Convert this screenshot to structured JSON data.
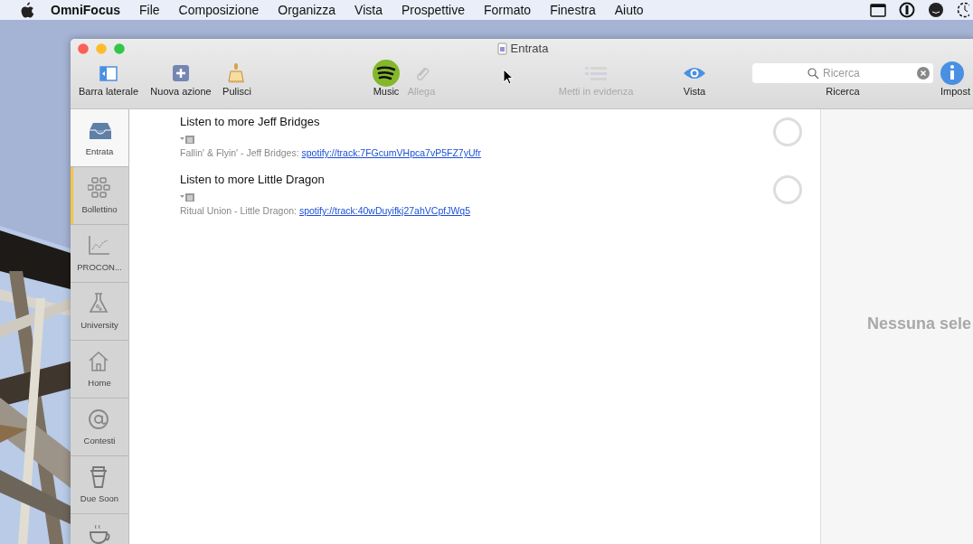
{
  "menu_bar": {
    "app": "OmniFocus",
    "menus": [
      "File",
      "Composizione",
      "Organizza",
      "Vista",
      "Prospettive",
      "Formato",
      "Finestra",
      "Aiuto"
    ]
  },
  "window": {
    "title": "Entrata"
  },
  "toolbar": {
    "items": [
      {
        "kind": "button",
        "label": "Barra laterale",
        "disabled": false
      },
      {
        "kind": "button",
        "label": "Nuova azione",
        "disabled": false
      },
      {
        "kind": "button",
        "label": "Pulisci",
        "disabled": false
      },
      {
        "kind": "button",
        "label": "Music",
        "disabled": false
      },
      {
        "kind": "button",
        "label": "Allega",
        "disabled": true
      },
      {
        "kind": "button",
        "label": "Metti in evidenza",
        "disabled": true
      },
      {
        "kind": "button",
        "label": "Vista",
        "disabled": false
      },
      {
        "kind": "search",
        "label": "Ricerca",
        "placeholder": "Ricerca"
      },
      {
        "kind": "button",
        "label": "Impost",
        "disabled": false
      }
    ]
  },
  "sidebar": {
    "items": [
      {
        "label": "Entrata",
        "selected": true,
        "highlighted": false
      },
      {
        "label": "Bollettino",
        "selected": false,
        "highlighted": true
      },
      {
        "label": "PROCON...",
        "selected": false,
        "highlighted": false
      },
      {
        "label": "University",
        "selected": false,
        "highlighted": false
      },
      {
        "label": "Home",
        "selected": false,
        "highlighted": false
      },
      {
        "label": "Contesti",
        "selected": false,
        "highlighted": false
      },
      {
        "label": "Due Soon",
        "selected": false,
        "highlighted": false
      },
      {
        "selected": false
      }
    ]
  },
  "tasks": [
    {
      "title": "Listen to more Jeff Bridges",
      "note": "Fallin' & Flyin' - Jeff Bridges: ",
      "link": "spotify://track:7FGcumVHpca7vP5FZ7yUfr",
      "checked": false
    },
    {
      "title": "Listen to more Little Dragon",
      "note": "Ritual Union - Little Dragon: ",
      "link": "spotify://track:40wDuyifkj27ahVCpfJWq5",
      "checked": false
    }
  ],
  "inspector": {
    "message": "Nessuna sele"
  }
}
